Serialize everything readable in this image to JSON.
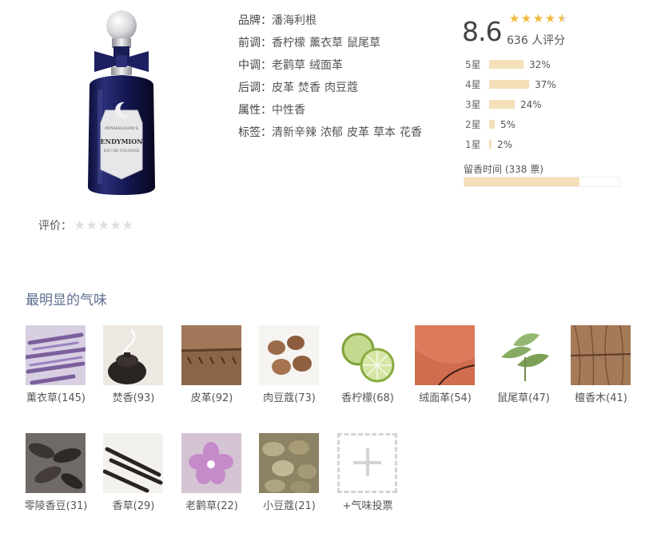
{
  "product": {
    "bottle_brand_text": "PENHALIGON'S",
    "bottle_name_text": "ENDYMION",
    "bottle_sub_text": "EAU DE COLOGNE"
  },
  "rate": {
    "label": "评价：",
    "stars": 5
  },
  "info": {
    "rows": [
      {
        "key": "品牌",
        "values": [
          "潘海利根"
        ]
      },
      {
        "key": "前调",
        "values": [
          "香柠檬",
          "薰衣草",
          "鼠尾草"
        ]
      },
      {
        "key": "中调",
        "values": [
          "老鹳草",
          "绒面革"
        ]
      },
      {
        "key": "后调",
        "values": [
          "皮革",
          "焚香",
          "肉豆蔻"
        ]
      },
      {
        "key": "属性",
        "values": [
          "中性香"
        ]
      },
      {
        "key": "标签",
        "values": [
          "清新辛辣",
          "浓郁",
          "皮革",
          "草本",
          "花香"
        ]
      }
    ],
    "sep": "："
  },
  "rating": {
    "score": "8.6",
    "stars": 4.3,
    "votes": "636 人评分",
    "distribution": [
      {
        "label": "5星",
        "percent": 32,
        "text": "32%"
      },
      {
        "label": "4星",
        "percent": 37,
        "text": "37%"
      },
      {
        "label": "3星",
        "percent": 24,
        "text": "24%"
      },
      {
        "label": "2星",
        "percent": 5,
        "text": "5%"
      },
      {
        "label": "1星",
        "percent": 2,
        "text": "2%"
      }
    ],
    "longevity_label": "留香时间 (338 票)",
    "longevity_fraction": 0.74
  },
  "colors": {
    "star": "#f2bb3c",
    "bar": "#f4dfb8",
    "title": "#5d6d8f"
  },
  "notes": {
    "title": "最明显的气味",
    "items": [
      {
        "name": "薰衣草",
        "count": "(145)",
        "icon": "lavender"
      },
      {
        "name": "焚香",
        "count": "(93)",
        "icon": "incense"
      },
      {
        "name": "皮革",
        "count": "(92)",
        "icon": "leather"
      },
      {
        "name": "肉豆蔻",
        "count": "(73)",
        "icon": "nutmeg"
      },
      {
        "name": "香柠檬",
        "count": "(68)",
        "icon": "bergamot"
      },
      {
        "name": "绒面革",
        "count": "(54)",
        "icon": "suede"
      },
      {
        "name": "鼠尾草",
        "count": "(47)",
        "icon": "sage"
      },
      {
        "name": "檀香木",
        "count": "(41)",
        "icon": "sandalwood"
      },
      {
        "name": "零陵香豆",
        "count": "(31)",
        "icon": "tonka-bean"
      },
      {
        "name": "香草",
        "count": "(29)",
        "icon": "vanilla"
      },
      {
        "name": "老鹳草",
        "count": "(22)",
        "icon": "geranium"
      },
      {
        "name": "小豆蔻",
        "count": "(21)",
        "icon": "cardamom"
      }
    ],
    "vote_label": "+气味投票"
  }
}
